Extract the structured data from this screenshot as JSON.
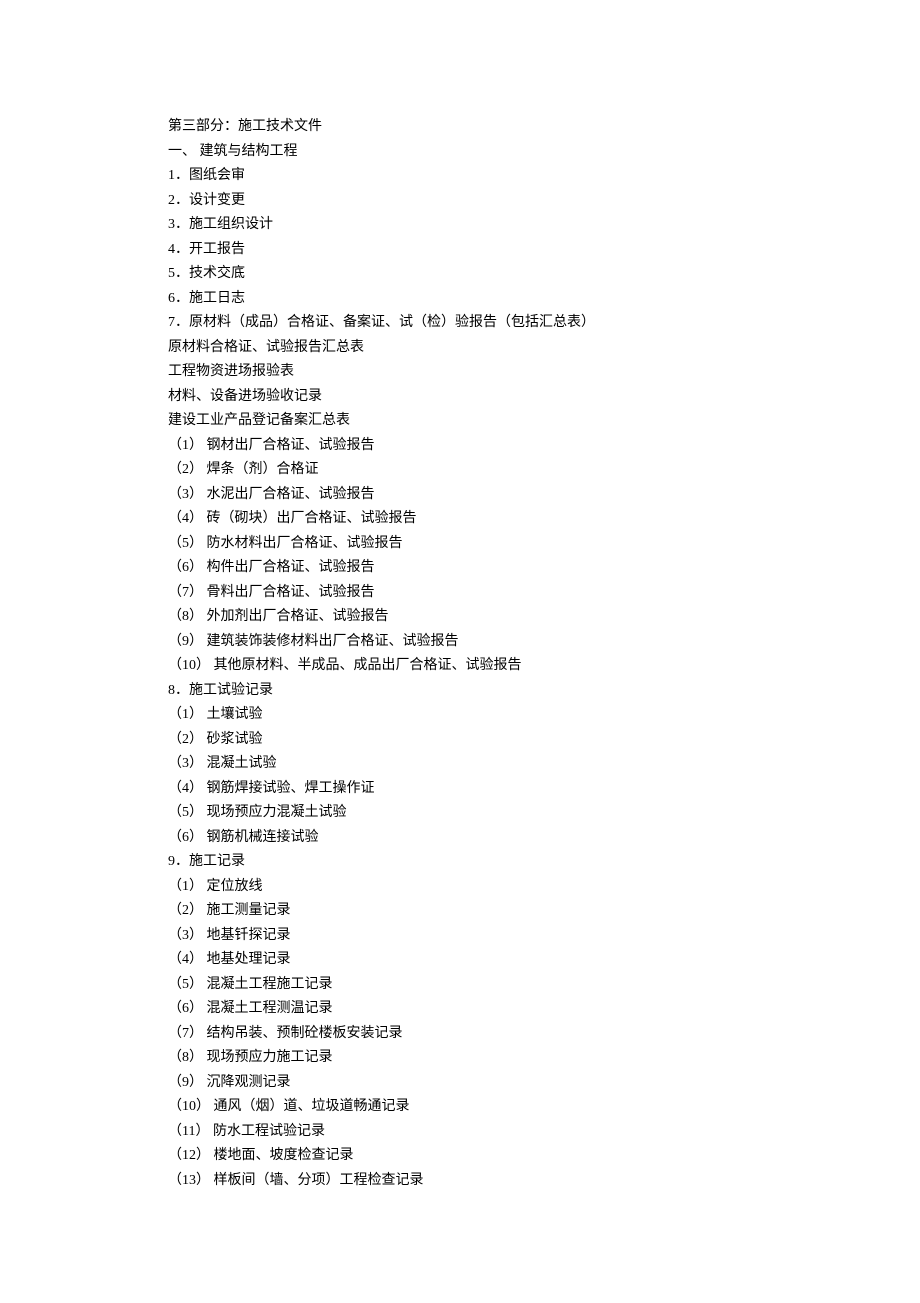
{
  "title": "第三部分：施工技术文件",
  "sectionHeading": "一、  建筑与结构工程",
  "items": [
    "1．图纸会审",
    "2．设计变更",
    "3．施工组织设计",
    "4．开工报告",
    "5．技术交底",
    "6．施工日志",
    "7．原材料（成品）合格证、备案证、试（检）验报告（包括汇总表）"
  ],
  "subTexts": [
    "原材料合格证、试验报告汇总表",
    "工程物资进场报验表",
    "材料、设备进场验收记录",
    "建设工业产品登记备案汇总表"
  ],
  "group7": [
    "（1）  钢材出厂合格证、试验报告",
    "（2）  焊条（剂）合格证",
    "（3）  水泥出厂合格证、试验报告",
    "（4）  砖（砌块）出厂合格证、试验报告",
    "（5）  防水材料出厂合格证、试验报告",
    "（6）  构件出厂合格证、试验报告",
    "（7）  骨料出厂合格证、试验报告",
    "（8）  外加剂出厂合格证、试验报告",
    "（9）  建筑装饰装修材料出厂合格证、试验报告",
    "（10）  其他原材料、半成品、成品出厂合格证、试验报告"
  ],
  "item8": "8．施工试验记录",
  "group8": [
    "（1）  土壤试验",
    "（2）  砂浆试验",
    "（3）  混凝土试验",
    "（4）  钢筋焊接试验、焊工操作证",
    "（5）  现场预应力混凝土试验",
    "（6）  钢筋机械连接试验"
  ],
  "item9": "9．施工记录",
  "group9": [
    "（1）  定位放线",
    "（2）  施工测量记录",
    "（3）  地基钎探记录",
    "（4）  地基处理记录",
    "（5）  混凝土工程施工记录",
    "（6）  混凝土工程测温记录",
    "（7）  结构吊装、预制砼楼板安装记录",
    "（8）  现场预应力施工记录",
    "（9）  沉降观测记录",
    "（10）  通风（烟）道、垃圾道畅通记录",
    "（11）  防水工程试验记录",
    "（12）  楼地面、坡度检查记录",
    "（13）  样板间（墙、分项）工程检查记录"
  ]
}
